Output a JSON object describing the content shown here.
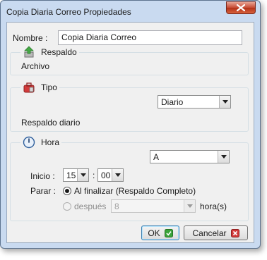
{
  "window": {
    "title": "Copia Diaria Correo Propiedades"
  },
  "name": {
    "label": "Nombre :",
    "value": "Copia Diaria Correo"
  },
  "respaldo": {
    "title": "Respaldo",
    "archivo_label": "Archivo",
    "icon": "backup-upload-icon"
  },
  "tipo": {
    "title": "Tipo",
    "select_value": "Diario",
    "description": "Respaldo diario",
    "icon": "toolbox-icon"
  },
  "hora": {
    "title": "Hora",
    "icon": "clock-icon",
    "select_value": "A",
    "inicio_label": "Inicio :",
    "hour_value": "15",
    "minute_value": "00",
    "colon": ":",
    "parar_label": "Parar :",
    "option_finish": "Al finalizar (Respaldo Completo)",
    "option_after": "después",
    "after_value": "8",
    "after_unit": "hora(s)"
  },
  "buttons": {
    "ok": "OK",
    "cancel": "Cancelar"
  },
  "colors": {
    "titlebar": "#c9daf0",
    "close": "#c74a34",
    "ok_check": "#3aa33a",
    "cancel_x": "#d23a3a"
  }
}
